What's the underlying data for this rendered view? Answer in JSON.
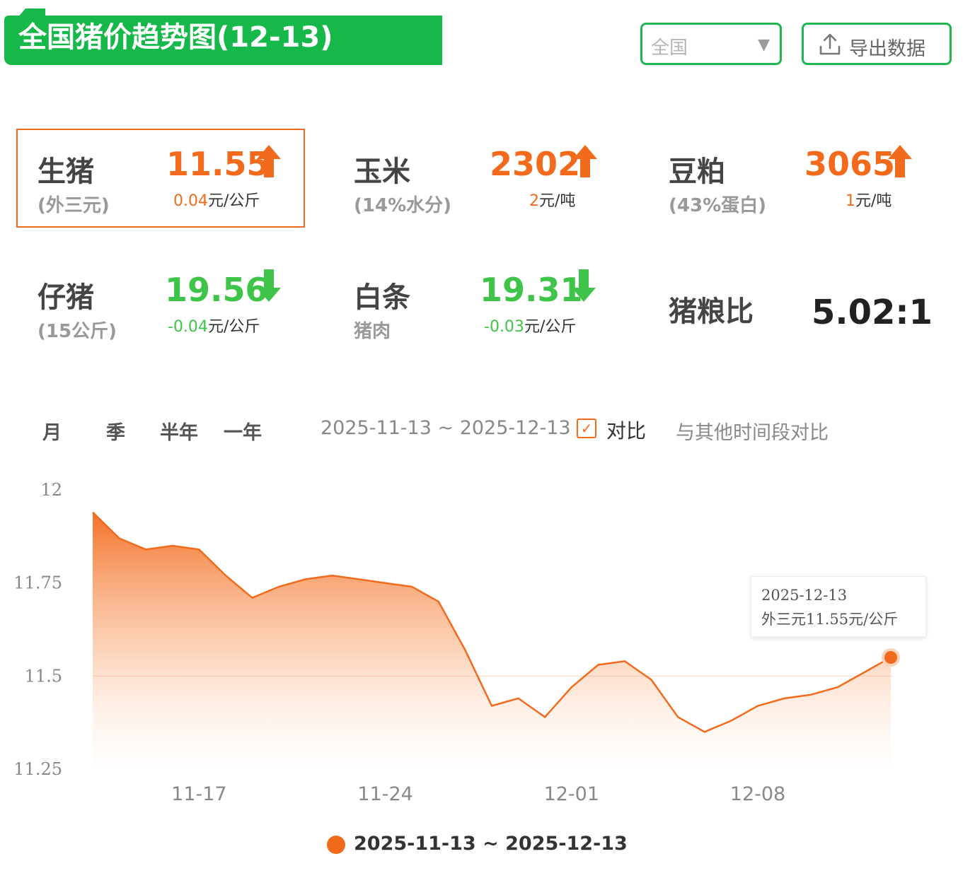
{
  "header": {
    "title": "全国猪价趋势图(12-13)",
    "region_select": {
      "value": "全国",
      "caret": "▼"
    },
    "export_button": {
      "label": "导出数据",
      "icon": "upload-icon"
    }
  },
  "metrics": {
    "hog": {
      "name": "生猪",
      "sub": "(外三元)",
      "value": "11.55",
      "direction": "up",
      "delta": "0.04",
      "unit": "元/公斤"
    },
    "corn": {
      "name": "玉米",
      "sub": "(14%水分)",
      "value": "2302",
      "direction": "up",
      "delta": "2",
      "unit": "元/吨"
    },
    "soymeal": {
      "name": "豆粕",
      "sub": "(43%蛋白)",
      "value": "3065",
      "direction": "up",
      "delta": "1",
      "unit": "元/吨"
    },
    "piglet": {
      "name": "仔猪",
      "sub": "(15公斤)",
      "value": "19.56",
      "direction": "down",
      "delta": "-0.04",
      "unit": "元/公斤"
    },
    "carcass": {
      "name": "白条",
      "sub": "猪肉",
      "value": "19.31",
      "direction": "down",
      "delta": "-0.03",
      "unit": "元/公斤"
    },
    "ratio": {
      "name": "猪粮比",
      "value": "5.02:1"
    }
  },
  "colors": {
    "brand_green": "#16b84a",
    "up_orange": "#f26b1d",
    "down_green": "#3fc44a"
  },
  "range_tabs": [
    "月",
    "季",
    "半年",
    "一年"
  ],
  "date_range": "2025-11-13 ~ 2025-12-13",
  "compare": {
    "checked": true,
    "label": "对比",
    "hint": "与其他时间段对比"
  },
  "tooltip": {
    "date": "2025-12-13",
    "text": "外三元11.55元/公斤"
  },
  "legend": {
    "label": "2025-11-13 ~ 2025-12-13"
  },
  "chart_data": {
    "type": "area",
    "ylim": [
      11.25,
      12
    ],
    "yticks": [
      "12",
      "11.75",
      "11.5",
      "11.25"
    ],
    "xticks": [
      "11-17",
      "11-24",
      "12-01",
      "12-08"
    ],
    "x": [
      "11-13",
      "11-14",
      "11-15",
      "11-16",
      "11-17",
      "11-18",
      "11-19",
      "11-20",
      "11-21",
      "11-22",
      "11-23",
      "11-24",
      "11-25",
      "11-26",
      "11-27",
      "11-28",
      "11-29",
      "11-30",
      "12-01",
      "12-02",
      "12-03",
      "12-04",
      "12-05",
      "12-06",
      "12-07",
      "12-08",
      "12-09",
      "12-10",
      "12-11",
      "12-12",
      "12-13"
    ],
    "series": [
      {
        "name": "2025-11-13 ~ 2025-12-13",
        "values": [
          11.94,
          11.87,
          11.84,
          11.85,
          11.84,
          11.77,
          11.71,
          11.74,
          11.76,
          11.77,
          11.76,
          11.75,
          11.74,
          11.7,
          11.57,
          11.42,
          11.44,
          11.39,
          11.47,
          11.53,
          11.54,
          11.49,
          11.39,
          11.35,
          11.38,
          11.42,
          11.44,
          11.45,
          11.47,
          11.51,
          11.55
        ]
      }
    ],
    "highlight_point": {
      "x": "12-13",
      "y": 11.55
    }
  }
}
